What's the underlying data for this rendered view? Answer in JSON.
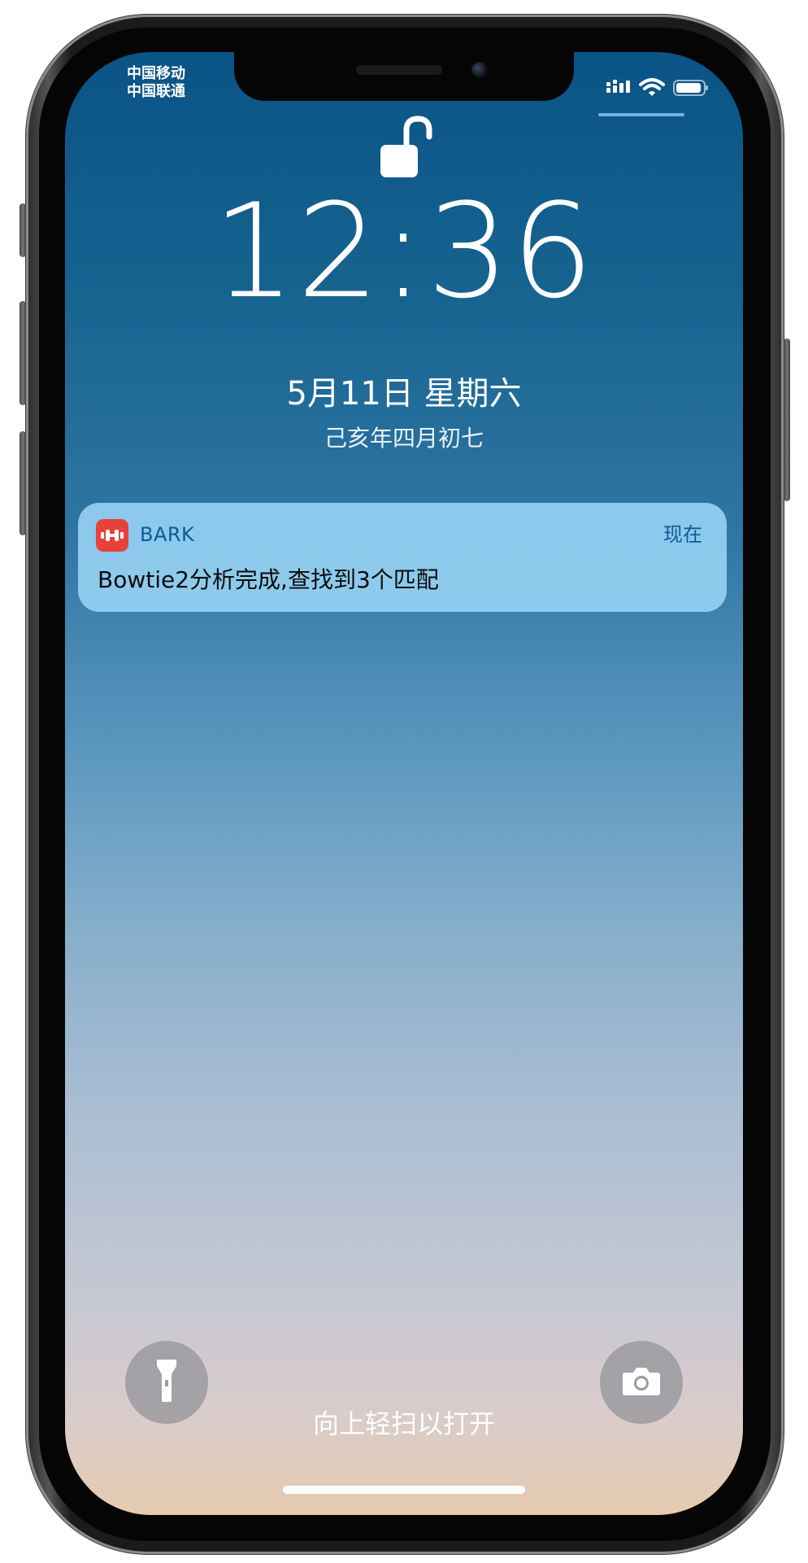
{
  "status_bar": {
    "carrier_line_1": "中国移动",
    "carrier_line_2": "中国联通",
    "icons": [
      "cellular-signal-icon",
      "wifi-icon",
      "battery-icon"
    ]
  },
  "lock_screen": {
    "lock_state_icon": "unlocked-padlock-icon",
    "time": "12:36",
    "date": "5月11日 星期六",
    "lunar_date": "己亥年四月初七",
    "swipe_hint": "向上轻扫以打开"
  },
  "notification": {
    "app_icon": "bark-app-icon",
    "app_name": "BARK",
    "time": "现在",
    "body": "Bowtie2分析完成,查找到3个匹配"
  },
  "quick_actions": {
    "left_icon": "flashlight-icon",
    "right_icon": "camera-icon"
  },
  "colors": {
    "wallpaper_top": "#0a5386",
    "wallpaper_bottom": "#e6cbb0",
    "notification_bg": "#95d0f2",
    "notification_accent": "#0e5a96",
    "app_icon_bg": "#e8413b"
  }
}
